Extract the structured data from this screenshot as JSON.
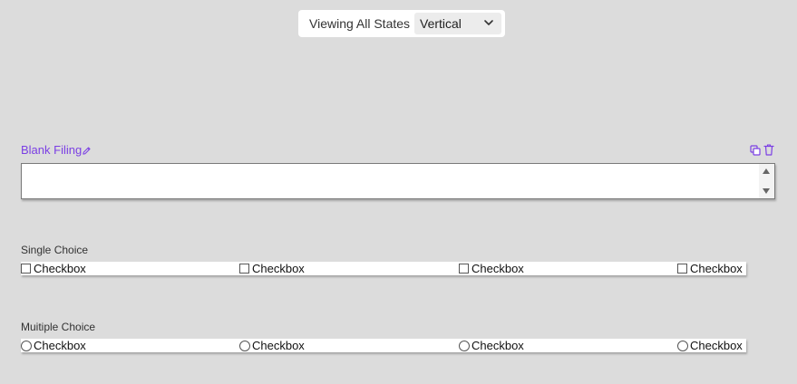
{
  "toolbar": {
    "label": "Viewing All States",
    "view_select": "Vertical"
  },
  "colors": {
    "accent": "#7b3fe4",
    "background": "#dcdcdc"
  },
  "blank_filing": {
    "title": "Blank Filing",
    "value": ""
  },
  "single_choice": {
    "label": "Single Choice",
    "options": [
      "Checkbox",
      "Checkbox",
      "Checkbox",
      "Checkbox"
    ]
  },
  "multiple_choice": {
    "label": "Muitiple Choice",
    "options": [
      "Checkbox",
      "Checkbox",
      "Checkbox",
      "Checkbox"
    ]
  },
  "icons": {
    "edit": "pencil-icon",
    "copy": "copy-icon",
    "delete": "trash-icon",
    "dropdown": "chevron-down-icon"
  }
}
